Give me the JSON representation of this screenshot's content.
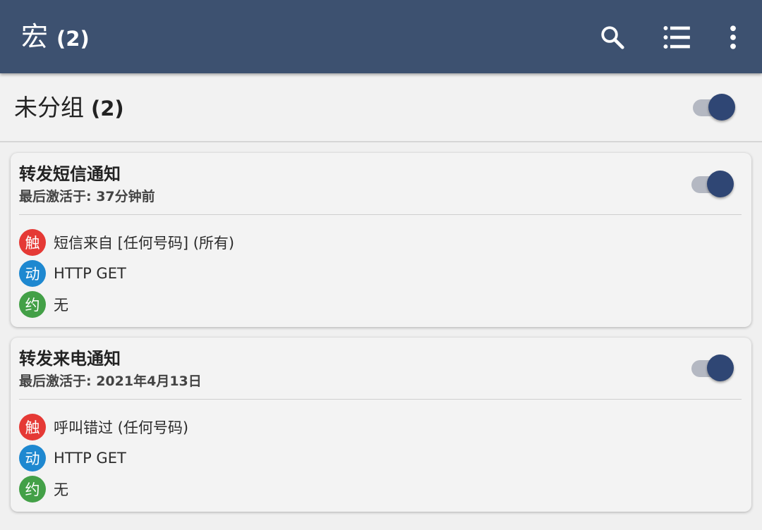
{
  "appbar": {
    "title": "宏",
    "count": "(2)",
    "background": "#3d5170",
    "icons": [
      "search-icon",
      "list-icon",
      "more-vert-icon"
    ]
  },
  "group": {
    "title": "未分组",
    "count": "(2)",
    "enabled": true
  },
  "colors": {
    "trigger": "#e53935",
    "action": "#1e88d0",
    "constraint": "#43a047",
    "toggle_thumb": "#2f4674"
  },
  "macros": [
    {
      "title": "转发短信通知",
      "last_active": "最后激活于: 37分钟前",
      "enabled": true,
      "trigger": {
        "badge": "触",
        "text": "短信来自 [任何号码] (所有)"
      },
      "action": {
        "badge": "动",
        "text": "HTTP GET"
      },
      "constraint": {
        "badge": "约",
        "text": "无"
      }
    },
    {
      "title": "转发来电通知",
      "last_active": "最后激活于: 2021年4月13日",
      "enabled": true,
      "trigger": {
        "badge": "触",
        "text": "呼叫错过 (任何号码)"
      },
      "action": {
        "badge": "动",
        "text": "HTTP GET"
      },
      "constraint": {
        "badge": "约",
        "text": "无"
      }
    }
  ]
}
